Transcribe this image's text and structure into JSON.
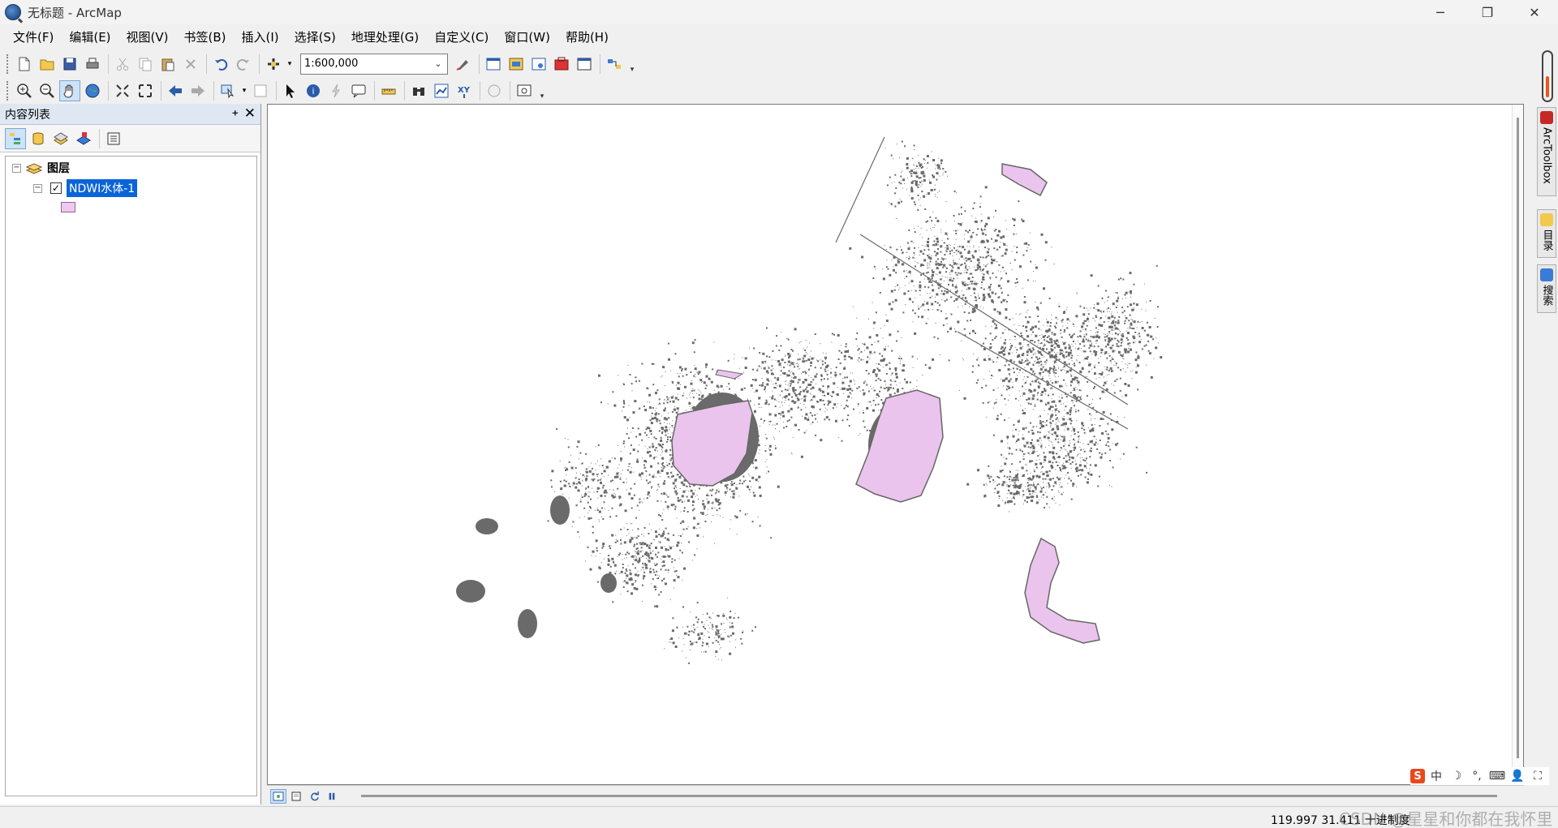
{
  "window": {
    "title": "无标题 - ArcMap",
    "minimize_glyph": "─",
    "restore_glyph": "❐",
    "close_glyph": "✕"
  },
  "menu": {
    "items": [
      "文件(F)",
      "编辑(E)",
      "视图(V)",
      "书签(B)",
      "插入(I)",
      "选择(S)",
      "地理处理(G)",
      "自定义(C)",
      "窗口(W)",
      "帮助(H)"
    ]
  },
  "toolbar": {
    "scale_value": "1:600,000"
  },
  "toc": {
    "title": "内容列表",
    "pin_glyph": "📌",
    "close_glyph": "✕",
    "group_name": "图层",
    "layer_name": "NDWI水体-1",
    "layer_checked": true,
    "layer_swatch_color": "#f0c8f0"
  },
  "map": {
    "feature_fill_color": "#eac4ec",
    "feature_stroke_color": "#666666",
    "dot_color": "#6a6a6a"
  },
  "right_dock": {
    "tabs": [
      "ArcToolbox",
      "目录",
      "搜索"
    ]
  },
  "ime": {
    "items": [
      "S",
      "中",
      "☽",
      "°,",
      "⌨",
      "👤",
      "⛶"
    ]
  },
  "status": {
    "coordinates": "119.997  31.411 十进制度"
  },
  "watermark": "CSDN @星星和你都在我怀里"
}
